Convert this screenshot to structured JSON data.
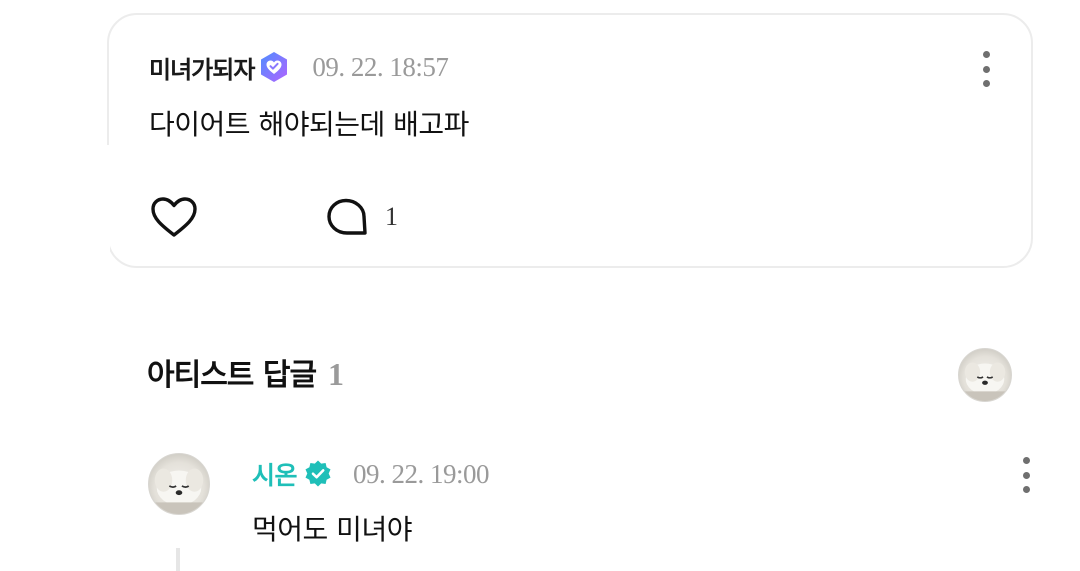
{
  "post": {
    "author": "미녀가되자",
    "badge_icon": "verified-fan-badge-icon",
    "timestamp": "09. 22. 18:57",
    "body": "다이어트 해야되는데 배고파",
    "like_icon": "heart-icon",
    "comment_icon": "comment-bubble-icon",
    "comment_count": "1"
  },
  "artist_replies": {
    "title": "아티스트 답글",
    "count": "1"
  },
  "reply": {
    "author": "시온",
    "badge_icon": "verified-artist-badge-icon",
    "timestamp": "09. 22. 19:00",
    "body": "먹어도 미녀야"
  },
  "colors": {
    "artist_name": "#1fbfb8",
    "timestamp": "#9a9a9a",
    "card_border": "#ececec",
    "fan_badge_start": "#5b8cff",
    "fan_badge_end": "#b56bff",
    "artist_badge": "#1fbfb8"
  }
}
